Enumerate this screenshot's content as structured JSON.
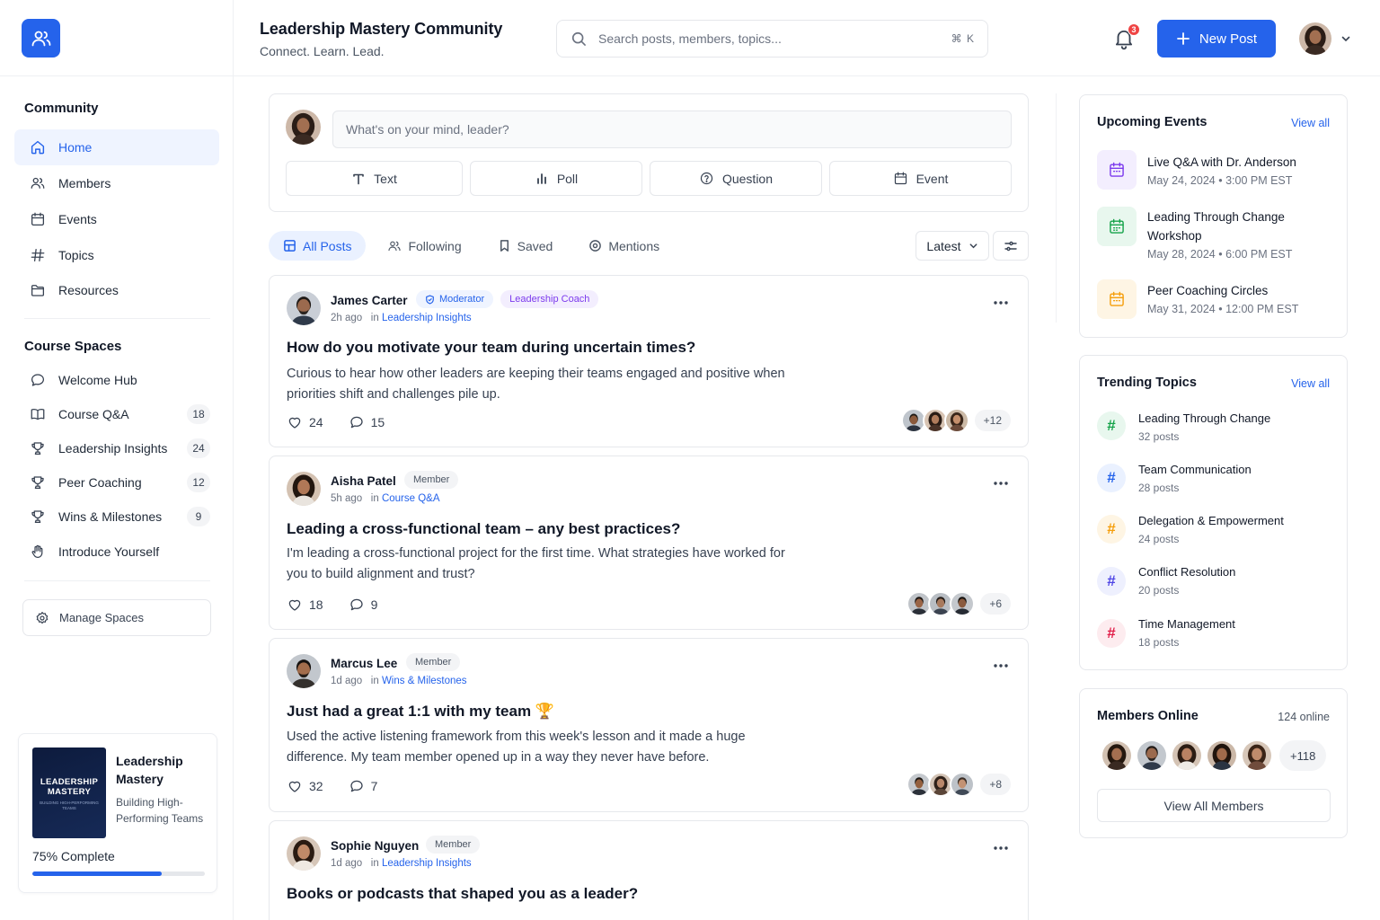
{
  "header": {
    "title": "Leadership Mastery Community",
    "subtitle": "Connect. Learn. Lead.",
    "search_placeholder": "Search posts, members, topics...",
    "search_shortcut": "⌘ K",
    "notification_count": "3",
    "new_post_label": "New Post",
    "accent": "#2563eb"
  },
  "sidebar": {
    "community_heading": "Community",
    "community_items": [
      {
        "label": "Home",
        "icon": "home-icon",
        "active": true
      },
      {
        "label": "Members",
        "icon": "users-icon"
      },
      {
        "label": "Events",
        "icon": "calendar-icon"
      },
      {
        "label": "Topics",
        "icon": "hash-icon"
      },
      {
        "label": "Resources",
        "icon": "folder-icon"
      }
    ],
    "spaces_heading": "Course Spaces",
    "spaces": [
      {
        "label": "Welcome Hub",
        "icon": "chat-bubble-icon",
        "count": ""
      },
      {
        "label": "Course Q&A",
        "icon": "book-icon",
        "count": "18"
      },
      {
        "label": "Leadership Insights",
        "icon": "trophy-icon",
        "count": "24"
      },
      {
        "label": "Peer Coaching",
        "icon": "trophy-icon",
        "count": "12"
      },
      {
        "label": "Wins & Milestones",
        "icon": "trophy-icon",
        "count": "9"
      },
      {
        "label": "Introduce Yourself",
        "icon": "wave-hand-icon",
        "count": ""
      }
    ],
    "manage_label": "Manage Spaces",
    "course": {
      "cover_title": "LEADERSHIP MASTERY",
      "cover_subtitle": "BUILDING HIGH-PERFORMING TEAMS",
      "title": "Leadership Mastery",
      "subtitle": "Building High-Performing Teams",
      "progress_label": "75% Complete",
      "progress": 0.75
    }
  },
  "composer": {
    "placeholder": "What's on your mind, leader?",
    "buttons": [
      {
        "label": "Text",
        "icon": "text-icon"
      },
      {
        "label": "Poll",
        "icon": "poll-icon"
      },
      {
        "label": "Question",
        "icon": "question-icon"
      },
      {
        "label": "Event",
        "icon": "calendar-icon"
      }
    ]
  },
  "feed": {
    "tabs": [
      {
        "label": "All Posts",
        "icon": "grid-icon",
        "active": true
      },
      {
        "label": "Following",
        "icon": "users-icon"
      },
      {
        "label": "Saved",
        "icon": "bookmark-icon"
      },
      {
        "label": "Mentions",
        "icon": "at-icon"
      }
    ],
    "sort_label": "Latest",
    "posts": [
      {
        "author": "James Carter",
        "badges": [
          {
            "label": "Moderator",
            "kind": "mod"
          },
          {
            "label": "Leadership Coach",
            "kind": "coach"
          }
        ],
        "time": "2h ago",
        "in_label": "in",
        "space": "Leadership Insights",
        "title": "How do you motivate your team during uncertain times?",
        "body": "Curious to hear how other leaders are keeping their teams engaged and positive when priorities shift and challenges pile up.",
        "likes": "24",
        "comments": "15",
        "extra": "+12"
      },
      {
        "author": "Aisha Patel",
        "badges": [
          {
            "label": "Member",
            "kind": "mem"
          }
        ],
        "time": "5h ago",
        "in_label": "in",
        "space": "Course Q&A",
        "title": "Leading a cross-functional team – any best practices?",
        "body": "I'm leading a cross-functional project for the first time. What strategies have worked for you to build alignment and trust?",
        "likes": "18",
        "comments": "9",
        "extra": "+6"
      },
      {
        "author": "Marcus Lee",
        "badges": [
          {
            "label": "Member",
            "kind": "mem"
          }
        ],
        "time": "1d ago",
        "in_label": "in",
        "space": "Wins & Milestones",
        "title": "Just had a great 1:1 with my team 🏆",
        "body": "Used the active listening framework from this week's lesson and it made a huge difference. My team member opened up in a way they never have before.",
        "likes": "32",
        "comments": "7",
        "extra": "+8"
      },
      {
        "author": "Sophie Nguyen",
        "badges": [
          {
            "label": "Member",
            "kind": "mem"
          }
        ],
        "time": "1d ago",
        "in_label": "in",
        "space": "Leadership Insights",
        "title": "Books or podcasts that shaped you as a leader?",
        "body": "",
        "likes": "",
        "comments": "",
        "extra": ""
      }
    ]
  },
  "events": {
    "heading": "Upcoming Events",
    "view_all": "View all",
    "items": [
      {
        "title": "Live Q&A with Dr. Anderson",
        "date": "May 24, 2024 • 3:00 PM EST",
        "color": "#7c3aed",
        "bg": "#f3eefe"
      },
      {
        "title": "Leading Through Change Workshop",
        "date": "May 28, 2024 • 6:00 PM EST",
        "color": "#16a34a",
        "bg": "#e8f7ee"
      },
      {
        "title": "Peer Coaching Circles",
        "date": "May 31, 2024 • 12:00 PM EST",
        "color": "#f59e0b",
        "bg": "#fef5e4"
      }
    ]
  },
  "topics": {
    "heading": "Trending Topics",
    "view_all": "View all",
    "items": [
      {
        "title": "Leading Through Change",
        "count": "32 posts",
        "color": "#16a34a",
        "bg": "#e8f7ee"
      },
      {
        "title": "Team Communication",
        "count": "28 posts",
        "color": "#2563eb",
        "bg": "#eaf1ff"
      },
      {
        "title": "Delegation & Empowerment",
        "count": "24 posts",
        "color": "#f59e0b",
        "bg": "#fef5e4"
      },
      {
        "title": "Conflict Resolution",
        "count": "20 posts",
        "color": "#4f46e5",
        "bg": "#eef0fe"
      },
      {
        "title": "Time Management",
        "count": "18 posts",
        "color": "#e11d48",
        "bg": "#fdecef"
      }
    ]
  },
  "members_online": {
    "heading": "Members Online",
    "count_label": "124 online",
    "extra": "+118",
    "view_all_label": "View All Members"
  }
}
